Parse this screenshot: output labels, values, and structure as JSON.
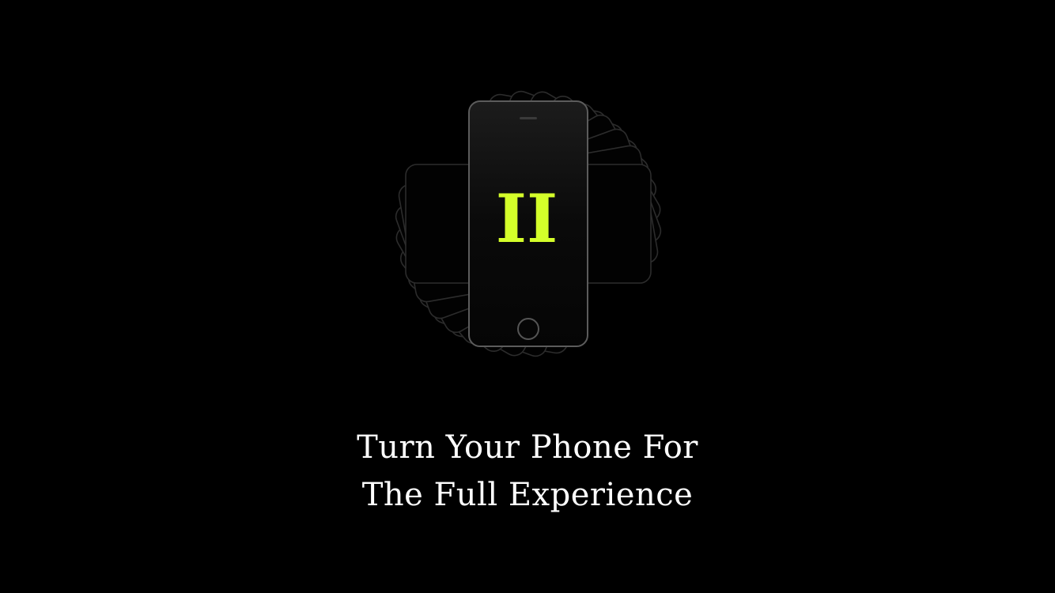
{
  "rotate_prompt": {
    "logo_text": "II",
    "line1": "Turn Your Phone For",
    "line2": "The Full Experience"
  },
  "colors": {
    "background": "#000000",
    "accent": "#d4ff2a",
    "text": "#ffffff",
    "phone_outline": "#5a5a5a",
    "ghost_outline": "#2c2c2c"
  },
  "icons": {
    "phone": "phone-icon",
    "rotation": "rotation-ghost-icon"
  }
}
